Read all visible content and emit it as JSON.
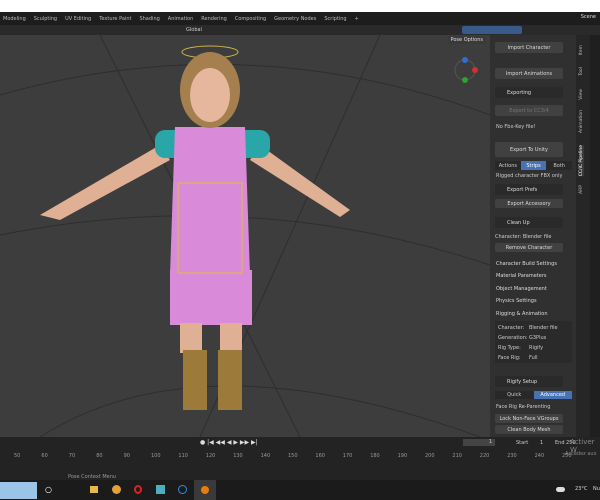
{
  "workspaces": [
    "Modeling",
    "Sculpting",
    "UV Editing",
    "Texture Paint",
    "Shading",
    "Animation",
    "Rendering",
    "Compositing",
    "Geometry Nodes",
    "Scripting",
    "+"
  ],
  "scene_label": "Scene",
  "header": {
    "orientation": "Global",
    "pose_options": "Pose Options"
  },
  "panel": {
    "import_character": "Import Character",
    "import_animations": "Import Animations",
    "exporting": "Exporting",
    "export_cc34": "Export to CC3/4",
    "no_fbx_key": "No Fbx-Key file!",
    "export_unity": "Export To Unity",
    "mode_tabs": [
      "Actions",
      "Strips",
      "Both"
    ],
    "mode_selected": "Strips",
    "rigged_fbx": "Rigged character FBX only",
    "export_prefs": "Export Prefs",
    "export_accessory": "Export Accessory",
    "clean_up": "Clean Up",
    "character_line": "Character: Blender file",
    "remove_character": "Remove Character",
    "sections": [
      "Character Build Settings",
      "Material Parameters",
      "Object Management",
      "Physics Settings",
      "Rigging & Animation"
    ],
    "info": [
      {
        "k": "Character:",
        "v": "Blender file"
      },
      {
        "k": "Generation:",
        "v": "G3Plus"
      },
      {
        "k": "Rig Type:",
        "v": "Rigify"
      },
      {
        "k": "Face Rig:",
        "v": "Full"
      }
    ],
    "rigify_setup": "Rigify Setup",
    "rigify_modes": [
      "Quick",
      "Advanced"
    ],
    "rigify_selected": "Advanced",
    "face_rig_reparent": "Face Rig Re-Parenting",
    "lock_non_face": "Lock Non-Face VGroups",
    "clean_body_mesh": "Clean Body Mesh"
  },
  "side_tabs": [
    "Item",
    "Tool",
    "View",
    "Animation",
    "CC/iC Pipeline",
    "ARP"
  ],
  "timeline": {
    "current_frame": "1",
    "start_label": "Start",
    "start": "1",
    "end_label": "End",
    "end": "250",
    "ticks": [
      "50",
      "60",
      "70",
      "80",
      "90",
      "100",
      "110",
      "120",
      "130",
      "140",
      "150",
      "160",
      "170",
      "180",
      "190",
      "200",
      "210",
      "220",
      "230",
      "240",
      "250"
    ],
    "watermark": "Activer W",
    "watermark2": "Accédez aux"
  },
  "status": {
    "hint": "Pose Context Menu"
  },
  "taskbar": {
    "weather": "23°C",
    "weather_tail": "Nu"
  },
  "colors": {
    "accent": "#4772b3",
    "pink": "#d98ad8",
    "teal": "#2aa5a8"
  }
}
